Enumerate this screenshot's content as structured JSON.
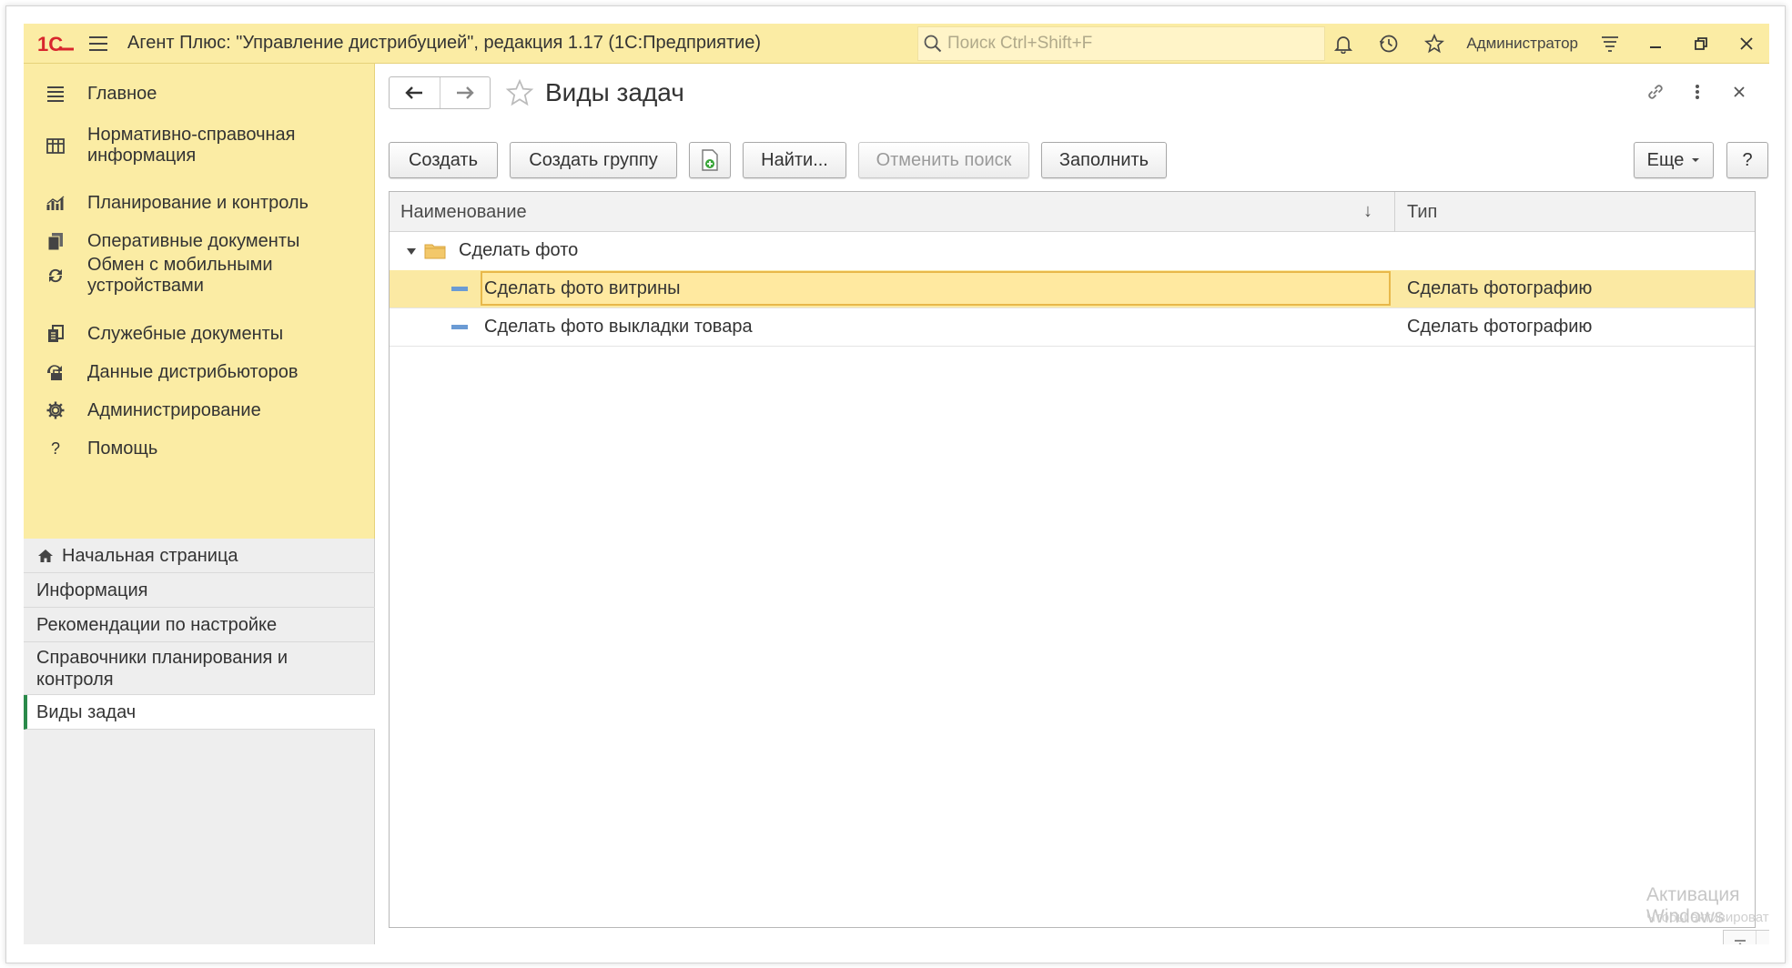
{
  "app": {
    "logo_text": "1С",
    "title": "Агент Плюс: \"Управление дистрибуцией\", редакция 1.17  (1С:Предприятие)",
    "search_placeholder": "Поиск Ctrl+Shift+F",
    "user": "Администратор",
    "title_icons": [
      "bell-icon",
      "history-icon",
      "star-icon",
      "settings-lines-icon",
      "minimize-icon",
      "restore-icon",
      "close-icon"
    ]
  },
  "sections": [
    {
      "label": "Главное",
      "icon": "menu-lines-icon"
    },
    {
      "label": "Нормативно-справочная информация",
      "icon": "catalog-grid-icon"
    },
    {
      "label": "Планирование и контроль",
      "icon": "bar-chart-icon"
    },
    {
      "label": "Оперативные документы",
      "icon": "documents-icon"
    },
    {
      "label": "Обмен с мобильными устройствами",
      "icon": "sync-icon"
    },
    {
      "label": "Служебные документы",
      "icon": "service-docs-icon"
    },
    {
      "label": "Данные дистрибьюторов",
      "icon": "distributor-icon"
    },
    {
      "label": "Администрирование",
      "icon": "gear-icon"
    },
    {
      "label": "Помощь",
      "icon": "question-icon"
    }
  ],
  "open_windows": [
    {
      "label": "Начальная страница",
      "icon": "home-icon"
    },
    {
      "label": "Информация"
    },
    {
      "label": "Рекомендации по настройке"
    },
    {
      "label": "Справочники планирования и контроля"
    },
    {
      "label": "Виды задач",
      "active": true
    }
  ],
  "form": {
    "title": "Виды задач",
    "buttons": {
      "create": "Создать",
      "create_group": "Создать группу",
      "find": "Найти...",
      "cancel_search": "Отменить поиск",
      "fill": "Заполнить",
      "more": "Еще",
      "help": "?"
    },
    "columns": {
      "name": "Наименование",
      "sort_indicator": "↓",
      "type": "Тип"
    },
    "rows": [
      {
        "kind": "group",
        "name": "Сделать фото",
        "type": ""
      },
      {
        "kind": "item",
        "name": "Сделать фото витрины",
        "type": "Сделать фотографию",
        "selected": true
      },
      {
        "kind": "item",
        "name": "Сделать фото выкладки товара",
        "type": "Сделать фотографию"
      }
    ]
  },
  "watermark": {
    "line1": "Активация Windows",
    "line2": "Чтобы активировать Windows, перейдите в раздел \"Параметры\"."
  },
  "colors": {
    "sidebar_bg": "#fbeca4",
    "selected_row": "#fbe9a3",
    "active_marker": "#2a8a4a",
    "logo_red": "#d8262d"
  }
}
